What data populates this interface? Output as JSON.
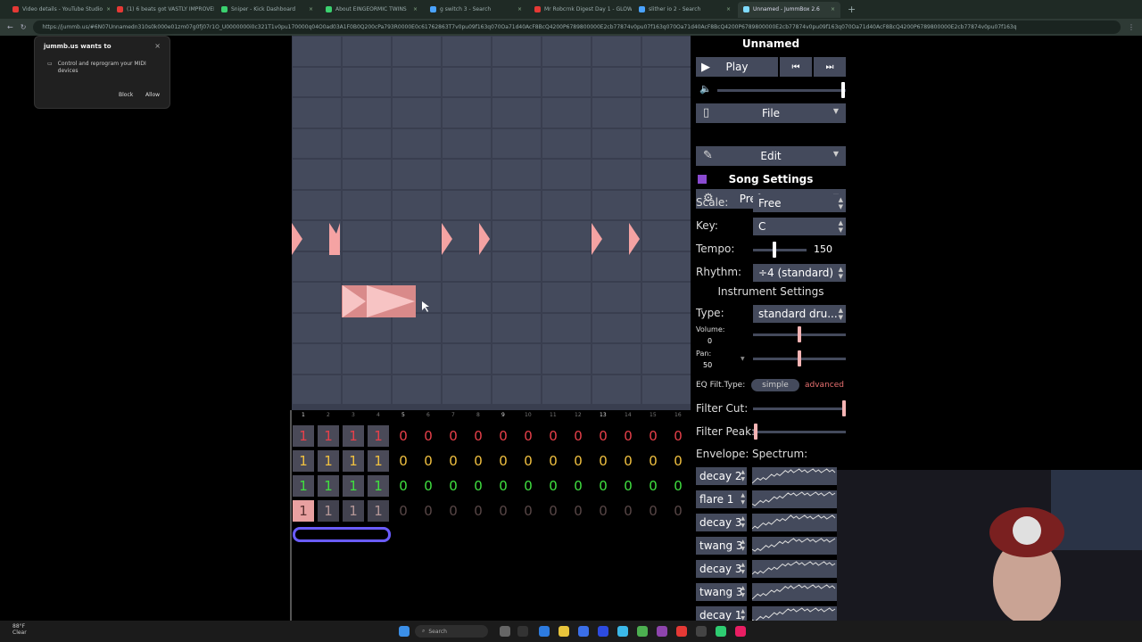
{
  "browser": {
    "tabs": [
      {
        "label": "Video details - YouTube Studio",
        "color": "#e53935"
      },
      {
        "label": "(1) 6 beats got VASTLY IMPROVED",
        "color": "#e53935"
      },
      {
        "label": "Sniper - Kick Dashboard",
        "color": "#3bd16f"
      },
      {
        "label": "About EINGEORMIC TWINS",
        "color": "#3bd16f"
      },
      {
        "label": "g switch 3 - Search",
        "color": "#4aa3ff"
      },
      {
        "label": "Mr Robcrnk Digest Day 1 - GLOW",
        "color": "#e53935"
      },
      {
        "label": "slither io 2 - Search",
        "color": "#4aa3ff"
      },
      {
        "label": "Unnamed - JummBox 2.6",
        "color": "#7fdbff"
      }
    ],
    "new_tab": "+",
    "url": "https://jummb.us/#6N07Unnamedn310s0k000e01zm07g0fj07r1O_U0000000i0c321T1v0pu170000q04O0ad03A1F0B0Q200cPa793R0000E0c61762863T7v0pu09f163q070Oa71d40AcF8BcQ4200P6789800000E2cb77874v0pu07f163q070Oa71d40AcF8BcQ4200P6789800000E2cb77874v0pu09f163q070Oa71d40AcF8BcQ4200P6789800000E2cb77874v0pu07f163q"
  },
  "midi_popup": {
    "title": "jummb.us wants to",
    "message": "Control and reprogram your MIDI devices",
    "block": "Block",
    "allow": "Allow",
    "close": "×"
  },
  "ticks": [
    "1",
    "2",
    "3",
    "4",
    "5",
    "6",
    "7",
    "8",
    "9",
    "10",
    "11",
    "12",
    "13",
    "14",
    "15",
    "16"
  ],
  "major_ticks": [
    "1",
    "5",
    "9",
    "13"
  ],
  "channels": [
    {
      "color": "#e8404a",
      "values": [
        "1",
        "1",
        "1",
        "1",
        "0",
        "0",
        "0",
        "0",
        "0",
        "0",
        "0",
        "0",
        "0",
        "0",
        "0",
        "0"
      ],
      "bg": "#3a3a48"
    },
    {
      "color": "#f0c040",
      "values": [
        "1",
        "1",
        "1",
        "1",
        "0",
        "0",
        "0",
        "0",
        "0",
        "0",
        "0",
        "0",
        "0",
        "0",
        "0",
        "0"
      ],
      "bg": "#3a3a48"
    },
    {
      "color": "#40e040",
      "values": [
        "1",
        "1",
        "1",
        "1",
        "0",
        "0",
        "0",
        "0",
        "0",
        "0",
        "0",
        "0",
        "0",
        "0",
        "0",
        "0"
      ],
      "bg": "#3a3a48"
    },
    {
      "color": "#c8a8a8",
      "values": [
        "1",
        "1",
        "1",
        "1",
        "0",
        "0",
        "0",
        "0",
        "0",
        "0",
        "0",
        "0",
        "0",
        "0",
        "0",
        "0"
      ],
      "bg": "#3a3a48"
    }
  ],
  "panel": {
    "song_title": "Unnamed",
    "play": "Play",
    "file": "File",
    "edit": "Edit",
    "preferences": "Preferences",
    "song_settings": "Song Settings",
    "scale_label": "Scale:",
    "scale_value": "Free",
    "key_label": "Key:",
    "key_value": "C",
    "tempo_label": "Tempo:",
    "tempo_value": "150",
    "rhythm_label": "Rhythm:",
    "rhythm_value": "÷4 (standard)",
    "instrument_settings": "Instrument Settings",
    "type_label": "Type:",
    "type_value": "standard dru...",
    "volume_label": "Volume:",
    "volume_value": "0",
    "pan_label": "Pan:",
    "pan_value": "50",
    "eq_label": "EQ Filt.Type:",
    "eq_simple": "simple",
    "eq_advanced": "advanced",
    "filter_cut_label": "Filter Cut:",
    "filter_peak_label": "Filter Peak:",
    "envelope_label": "Envelope:",
    "spectrum_label": "Spectrum:",
    "envelopes": [
      "decay 2",
      "flare 1",
      "decay 3",
      "twang 3",
      "decay 3",
      "twang 3",
      "decay 1"
    ]
  },
  "taskbar": {
    "weather_temp": "88°F",
    "weather_desc": "Clear",
    "search": "Search"
  },
  "colors": {
    "note_pink": "#f5a3a3",
    "pattern_bg": "#393e4f",
    "cell_bg": "#444a5c",
    "loop_outline": "#6a5cff"
  }
}
